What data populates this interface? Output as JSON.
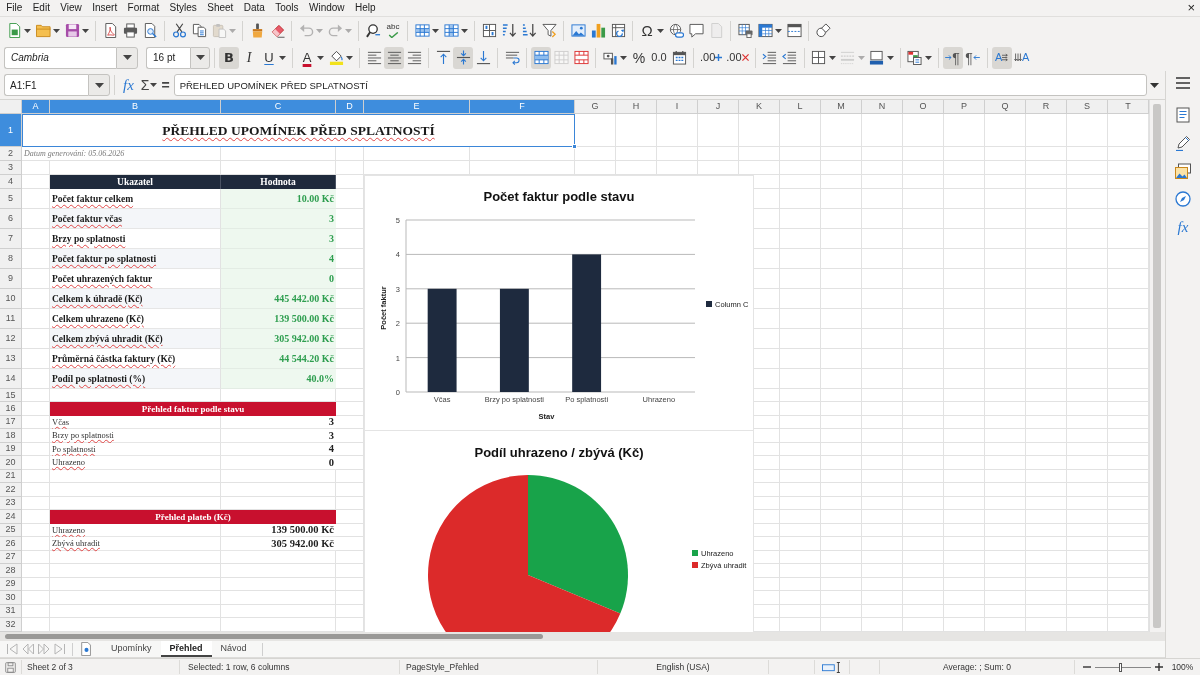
{
  "menu_bar": {
    "items": [
      "File",
      "Edit",
      "View",
      "Insert",
      "Format",
      "Styles",
      "Sheet",
      "Data",
      "Tools",
      "Window",
      "Help"
    ],
    "close": "×"
  },
  "standard_toolbar": {
    "groups": [
      [
        {
          "kind": "new",
          "menu": true,
          "disabled": false
        },
        {
          "kind": "open",
          "menu": true,
          "disabled": false
        },
        {
          "kind": "save",
          "menu": true,
          "disabled": false
        }
      ],
      [
        {
          "kind": "pdf",
          "menu": false,
          "disabled": false
        },
        {
          "kind": "print",
          "menu": false,
          "disabled": false
        },
        {
          "kind": "preview",
          "menu": false,
          "disabled": false
        }
      ],
      [
        {
          "kind": "cut",
          "menu": false,
          "disabled": false
        },
        {
          "kind": "copy",
          "menu": false,
          "disabled": false
        },
        {
          "kind": "paste",
          "menu": true,
          "disabled": true
        }
      ],
      [
        {
          "kind": "brush",
          "menu": false,
          "disabled": false
        },
        {
          "kind": "eraser",
          "menu": false,
          "disabled": false
        }
      ],
      [
        {
          "kind": "undo",
          "menu": true,
          "disabled": true
        },
        {
          "kind": "redo",
          "menu": true,
          "disabled": true
        }
      ],
      [
        {
          "kind": "find",
          "menu": false,
          "disabled": false
        },
        {
          "kind": "spelling",
          "label": "abc",
          "menu": false,
          "disabled": false
        }
      ],
      [
        {
          "kind": "rows",
          "menu": true,
          "disabled": false
        },
        {
          "kind": "columns",
          "menu": true,
          "disabled": false
        }
      ],
      [
        {
          "kind": "sort",
          "menu": false,
          "disabled": false
        },
        {
          "kind": "ascending",
          "menu": false,
          "disabled": false
        },
        {
          "kind": "descending",
          "menu": false,
          "disabled": false
        },
        {
          "kind": "filter",
          "menu": false,
          "disabled": false
        }
      ],
      [
        {
          "kind": "image",
          "menu": false,
          "disabled": false
        },
        {
          "kind": "chart",
          "menu": false,
          "disabled": false
        },
        {
          "kind": "pivot",
          "menu": false,
          "disabled": false
        }
      ],
      [
        {
          "kind": "symbol",
          "label": "Ω",
          "menu": true,
          "disabled": false
        },
        {
          "kind": "hyperlink",
          "menu": false,
          "disabled": false
        },
        {
          "kind": "comment",
          "menu": false,
          "disabled": false
        },
        {
          "kind": "header",
          "menu": false,
          "disabled": true
        }
      ],
      [
        {
          "kind": "printarea",
          "menu": false,
          "disabled": false
        },
        {
          "kind": "freeze",
          "menu": true,
          "disabled": false
        },
        {
          "kind": "split",
          "menu": false,
          "disabled": false
        }
      ],
      [
        {
          "kind": "shapes",
          "menu": false,
          "disabled": false
        }
      ]
    ]
  },
  "format_toolbar": {
    "font_name": "Cambria",
    "font_size": "16 pt",
    "groups": [
      [
        {
          "kind": "bold",
          "label": "B",
          "pressed": true,
          "disabled": false,
          "menu": false
        },
        {
          "kind": "italic",
          "label": "I",
          "pressed": false,
          "disabled": false,
          "menu": false
        },
        {
          "kind": "underline",
          "label": "U",
          "pressed": false,
          "disabled": false,
          "menu": true
        }
      ],
      [
        {
          "kind": "fontcolor",
          "label": "A",
          "pressed": false,
          "disabled": false,
          "menu": true
        },
        {
          "kind": "highlight",
          "pressed": false,
          "disabled": false,
          "menu": true
        }
      ],
      [
        {
          "kind": "alignleft",
          "pressed": false,
          "disabled": false,
          "menu": false
        },
        {
          "kind": "aligncenter",
          "pressed": true,
          "disabled": false,
          "menu": false
        },
        {
          "kind": "alignright",
          "pressed": false,
          "disabled": false,
          "menu": false
        }
      ],
      [
        {
          "kind": "aligntop",
          "pressed": false,
          "disabled": false,
          "menu": false
        },
        {
          "kind": "alignmiddle",
          "pressed": true,
          "disabled": false,
          "menu": false
        },
        {
          "kind": "alignbottom",
          "pressed": false,
          "disabled": false,
          "menu": false
        }
      ],
      [
        {
          "kind": "wrap",
          "pressed": false,
          "disabled": false,
          "menu": false
        }
      ],
      [
        {
          "kind": "mergecenter",
          "pressed": true,
          "disabled": false,
          "menu": false
        },
        {
          "kind": "unmerge",
          "pressed": false,
          "disabled": true,
          "menu": false
        },
        {
          "kind": "merge",
          "pressed": false,
          "disabled": false,
          "menu": false
        }
      ],
      [
        {
          "kind": "currency",
          "pressed": false,
          "disabled": false,
          "menu": true
        },
        {
          "kind": "percent",
          "label": "%",
          "pressed": false,
          "disabled": false,
          "menu": false
        },
        {
          "kind": "number",
          "label": "0.0",
          "pressed": false,
          "disabled": false,
          "menu": false
        },
        {
          "kind": "date",
          "pressed": false,
          "disabled": false,
          "menu": false
        }
      ],
      [
        {
          "kind": "adddecimal",
          "label": ".00",
          "pressed": false,
          "disabled": false,
          "menu": false
        },
        {
          "kind": "deletedecimal",
          "label": ".00",
          "pressed": false,
          "disabled": false,
          "menu": false
        }
      ],
      [
        {
          "kind": "indent",
          "pressed": false,
          "disabled": false,
          "menu": false
        },
        {
          "kind": "outdent",
          "pressed": false,
          "disabled": false,
          "menu": false
        }
      ],
      [
        {
          "kind": "borders",
          "pressed": false,
          "disabled": false,
          "menu": true
        },
        {
          "kind": "borderstyle",
          "pressed": false,
          "disabled": true,
          "menu": true
        },
        {
          "kind": "bordercolor",
          "pressed": false,
          "disabled": false,
          "menu": true
        }
      ],
      [
        {
          "kind": "conditional",
          "pressed": false,
          "disabled": false,
          "menu": true
        }
      ],
      [
        {
          "kind": "ltr",
          "label": "¶",
          "pressed": true,
          "disabled": false,
          "menu": false
        },
        {
          "kind": "rtl",
          "label": "¶",
          "pressed": false,
          "disabled": false,
          "menu": false
        }
      ],
      [
        {
          "kind": "textltr",
          "label": "A",
          "pressed": true,
          "disabled": false,
          "menu": false
        },
        {
          "kind": "textvertical",
          "label": "A",
          "pressed": false,
          "disabled": false,
          "menu": false
        }
      ]
    ]
  },
  "formula_bar": {
    "name_box": "A1:F1",
    "function_wizard": "fx",
    "sum": "Σ",
    "equals": "=",
    "content": "PŘEHLED UPOMÍNEK PŘED SPLATNOSTÍ"
  },
  "sidebar": {
    "items": [
      {
        "kind": "menu"
      },
      {
        "kind": "properties"
      },
      {
        "kind": "styles"
      },
      {
        "kind": "gallery"
      },
      {
        "kind": "navigator"
      },
      {
        "kind": "functions",
        "label": "fx"
      }
    ]
  },
  "sheet": {
    "columns": [
      {
        "label": "A",
        "selected": true
      },
      {
        "label": "B",
        "selected": true
      },
      {
        "label": "C",
        "selected": true
      },
      {
        "label": "D",
        "selected": true
      },
      {
        "label": "E",
        "selected": true
      },
      {
        "label": "F",
        "selected": true
      },
      {
        "label": "G",
        "selected": false
      },
      {
        "label": "H",
        "selected": false
      },
      {
        "label": "I",
        "selected": false
      },
      {
        "label": "J",
        "selected": false
      },
      {
        "label": "K",
        "selected": false
      },
      {
        "label": "L",
        "selected": false
      },
      {
        "label": "M",
        "selected": false
      },
      {
        "label": "N",
        "selected": false
      },
      {
        "label": "O",
        "selected": false
      },
      {
        "label": "P",
        "selected": false
      },
      {
        "label": "Q",
        "selected": false
      },
      {
        "label": "R",
        "selected": false
      },
      {
        "label": "S",
        "selected": false
      },
      {
        "label": "T",
        "selected": false
      }
    ],
    "rows": [
      {
        "label": "1",
        "selected": true
      },
      {
        "label": "2",
        "selected": false
      },
      {
        "label": "3",
        "selected": false
      },
      {
        "label": "4",
        "selected": false
      },
      {
        "label": "5",
        "selected": false
      },
      {
        "label": "6",
        "selected": false
      },
      {
        "label": "7",
        "selected": false
      },
      {
        "label": "8",
        "selected": false
      },
      {
        "label": "9",
        "selected": false
      },
      {
        "label": "10",
        "selected": false
      },
      {
        "label": "11",
        "selected": false
      },
      {
        "label": "12",
        "selected": false
      },
      {
        "label": "13",
        "selected": false
      },
      {
        "label": "14",
        "selected": false
      },
      {
        "label": "15",
        "selected": false
      },
      {
        "label": "16",
        "selected": false
      },
      {
        "label": "17",
        "selected": false
      },
      {
        "label": "18",
        "selected": false
      },
      {
        "label": "19",
        "selected": false
      },
      {
        "label": "20",
        "selected": false
      },
      {
        "label": "21",
        "selected": false
      },
      {
        "label": "22",
        "selected": false
      },
      {
        "label": "23",
        "selected": false
      },
      {
        "label": "24",
        "selected": false
      },
      {
        "label": "25",
        "selected": false
      },
      {
        "label": "26",
        "selected": false
      },
      {
        "label": "27",
        "selected": false
      },
      {
        "label": "28",
        "selected": false
      },
      {
        "label": "29",
        "selected": false
      },
      {
        "label": "30",
        "selected": false
      },
      {
        "label": "31",
        "selected": false
      },
      {
        "label": "32",
        "selected": false
      }
    ],
    "title": {
      "text": "PŘEHLED UPOMÍNEK PŘED SPLATNOSTÍ",
      "selected": true
    },
    "date_note": "Datum generování: 05.06.2026",
    "summary_table": {
      "columns": [
        "Ukazatel",
        "Hodnota"
      ],
      "rows": [
        {
          "label": "Počet faktur celkem",
          "value": "10.00 Kč"
        },
        {
          "label": "Počet faktur včas",
          "value": "3"
        },
        {
          "label": "Brzy po splatnosti",
          "value": "3"
        },
        {
          "label": "Počet faktur po splatnosti",
          "value": "4"
        },
        {
          "label": "Počet uhrazených faktur",
          "value": "0"
        },
        {
          "label": "Celkem k úhradě (Kč)",
          "value": "445 442.00 Kč"
        },
        {
          "label": "Celkem uhrazeno (Kč)",
          "value": "139 500.00 Kč"
        },
        {
          "label": "Celkem zbývá uhradit (Kč)",
          "value": "305 942.00 Kč"
        },
        {
          "label": "Průměrná částka faktury (Kč)",
          "value": "44 544.20 Kč"
        },
        {
          "label": "Podíl po splatnosti (%)",
          "value": "40.0%"
        }
      ]
    },
    "status_table": {
      "title": "Přehled faktur podle stavu",
      "rows": [
        {
          "label": "Včas",
          "value": "3"
        },
        {
          "label": "Brzy po splatnosti",
          "value": "3"
        },
        {
          "label": "Po splatnosti",
          "value": "4"
        },
        {
          "label": "Uhrazeno",
          "value": "0"
        }
      ]
    },
    "payments_table": {
      "title": "Přehled plateb (Kč)",
      "rows": [
        {
          "label": "Uhrazeno",
          "value": "139 500.00 Kč"
        },
        {
          "label": "Zbývá uhradit",
          "value": "305 942.00 Kč"
        }
      ]
    },
    "bar_chart": {
      "chart_data": {
        "type": "bar",
        "title": "Počet faktur podle stavu",
        "xlabel": "Stav",
        "ylabel": "Počet faktur",
        "categories": [
          "Včas",
          "Brzy po splatnosti",
          "Po splatnosti",
          "Uhrazeno"
        ],
        "series": [
          {
            "name": "Column C",
            "color": "#1e2a3e",
            "values": [
              3,
              3,
              4,
              0
            ]
          }
        ],
        "ylim": [
          0,
          5
        ],
        "yticks": [
          0,
          1,
          2,
          3,
          4,
          5
        ],
        "grid": true,
        "legend": "right"
      }
    },
    "pie_chart": {
      "chart_data": {
        "type": "pie",
        "title": "Podíl uhrazeno / zbývá (Kč)",
        "categories": [
          "Uhrazeno",
          "Zbývá uhradit"
        ],
        "values": [
          31.3,
          68.7
        ],
        "colors": [
          "#18a34a",
          "#dc2a2a"
        ],
        "legend": "right"
      }
    }
  },
  "sheet_tabs": {
    "navigation_disabled": true,
    "tabs": [
      {
        "label": "Upomínky",
        "selected": false
      },
      {
        "label": "Přehled",
        "selected": true
      },
      {
        "label": "Návod",
        "selected": false
      }
    ]
  },
  "status_bar": {
    "sheet": "Sheet 2 of 3",
    "selection": "Selected: 1 row, 6 columns",
    "page_style": "PageStyle_Přehled",
    "language": "English (USA)",
    "statistics": "Average: ; Sum: 0",
    "zoom": {
      "level": 0.45,
      "label": "100%"
    }
  }
}
